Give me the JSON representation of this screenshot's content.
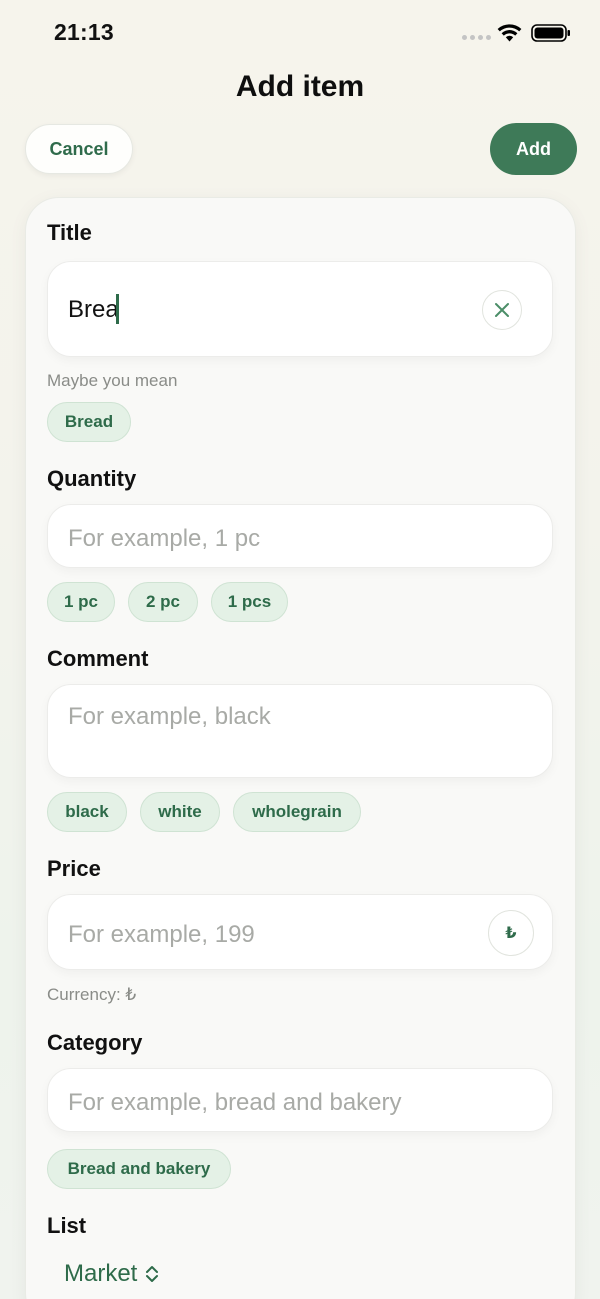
{
  "status_bar": {
    "time": "21:13"
  },
  "header": {
    "title": "Add item",
    "cancel_label": "Cancel",
    "add_label": "Add"
  },
  "form": {
    "title": {
      "label": "Title",
      "value": "Brea",
      "suggestion_hint": "Maybe you mean",
      "suggestions": [
        "Bread"
      ]
    },
    "quantity": {
      "label": "Quantity",
      "placeholder": "For example, 1 pc",
      "chips": [
        "1 pc",
        "2 pc",
        "1 pcs"
      ]
    },
    "comment": {
      "label": "Comment",
      "placeholder": "For example, black",
      "chips": [
        "black",
        "white",
        "wholegrain"
      ]
    },
    "price": {
      "label": "Price",
      "placeholder": "For example, 199",
      "currency_symbol": "₺",
      "currency_note": "Currency: ₺"
    },
    "category": {
      "label": "Category",
      "placeholder": "For example, bread and bakery",
      "chips": [
        "Bread and bakery"
      ]
    },
    "list": {
      "label": "List",
      "value": "Market"
    }
  },
  "colors": {
    "accent": "#3e7a58",
    "accent_text": "#2e6b4a",
    "chip_bg": "#e4f1e6",
    "background": "#f4f4ee"
  },
  "icons": {
    "clear": "close-icon",
    "list_select": "chevron-up-down-icon"
  }
}
